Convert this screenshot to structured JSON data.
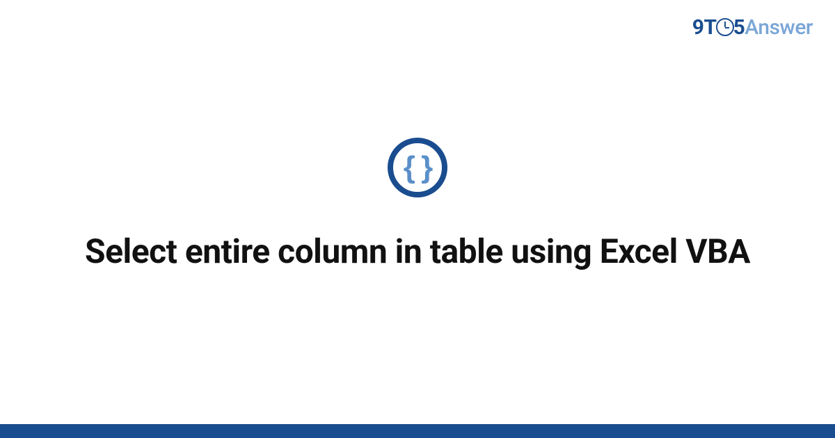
{
  "logo": {
    "nine": "9",
    "t": "T",
    "five": "5",
    "answer": "Answer"
  },
  "icon": {
    "braces": "{ }"
  },
  "title": "Select entire column in table using Excel VBA",
  "colors": {
    "brand_dark": "#1a4d8f",
    "brand_light": "#7aa6d6",
    "accent": "#5a8fc9"
  }
}
